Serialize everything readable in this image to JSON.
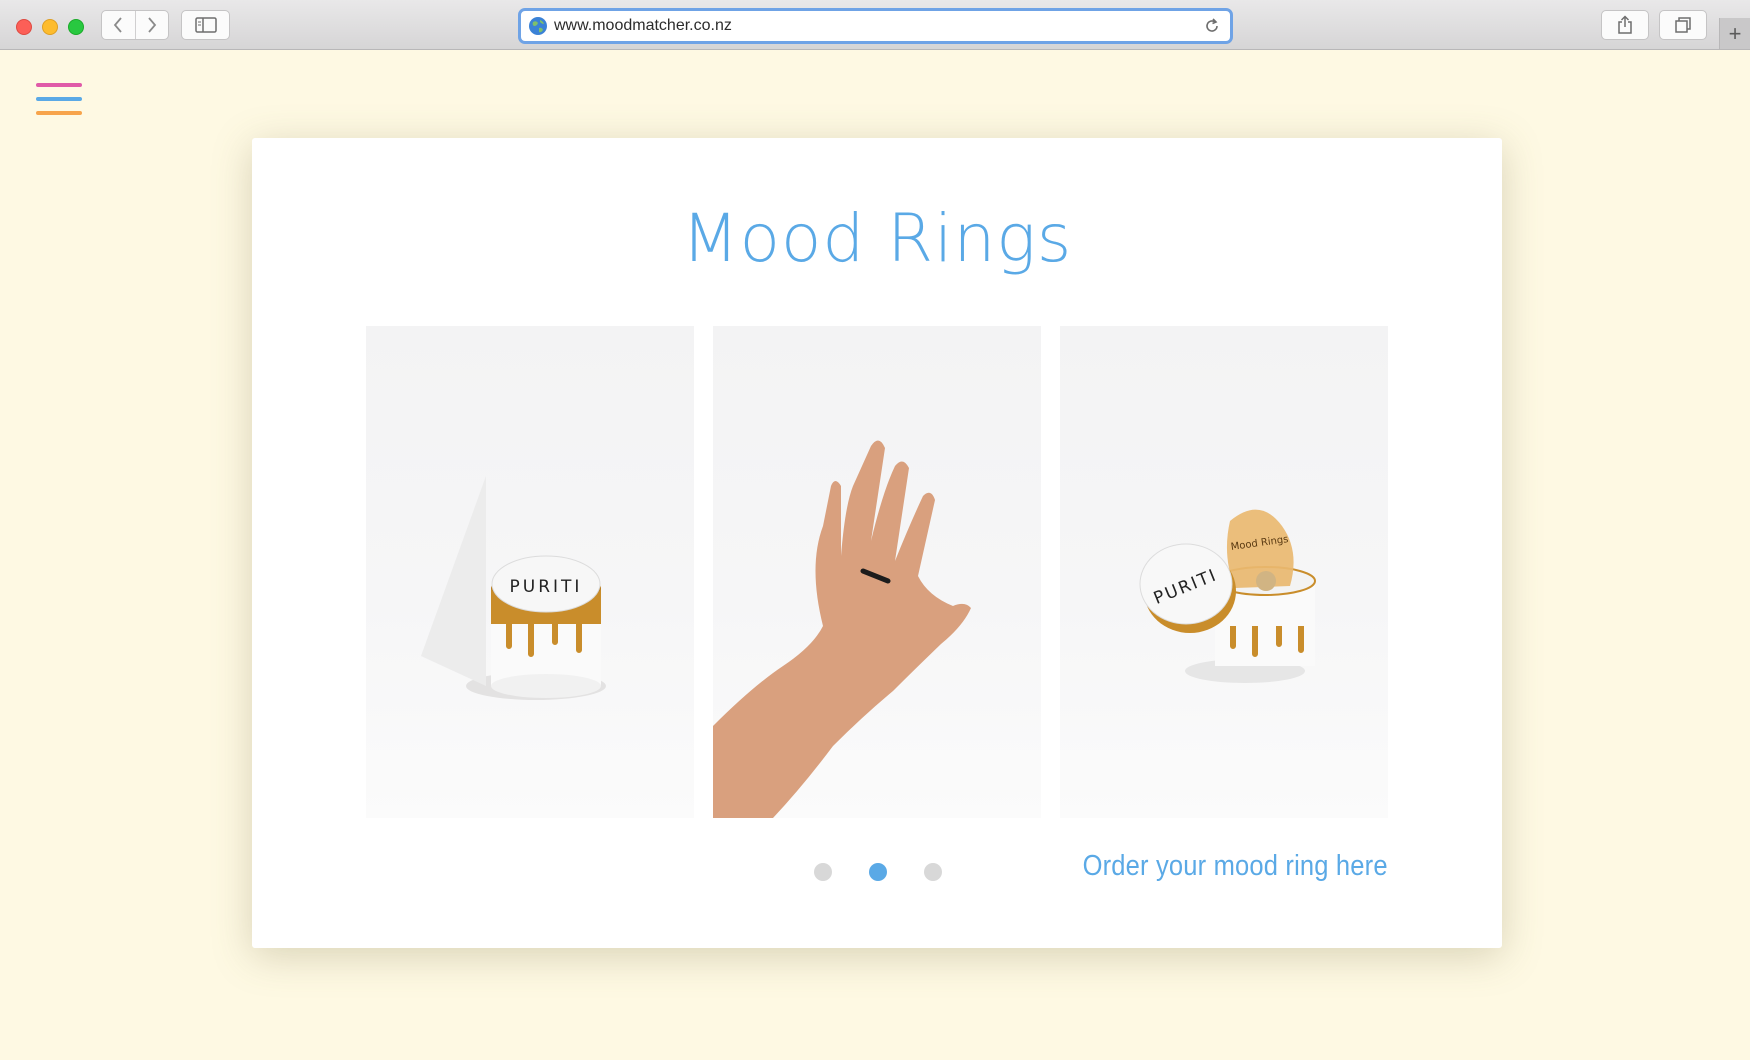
{
  "browser": {
    "url": "www.moodmatcher.co.nz",
    "newtab_label": "+"
  },
  "page": {
    "title": "Mood Rings",
    "cta_label": "Order your mood ring here",
    "carousel": {
      "slides": [
        {
          "brand_text": "PURITI"
        },
        {
          "brand_text": ""
        },
        {
          "brand_text": "PURITI",
          "bag_text": "Mood Rings"
        }
      ],
      "active_index": 1,
      "dot_count": 3
    }
  },
  "colors": {
    "accent": "#5aa9e6",
    "background": "#fef9e3",
    "menu_line_1": "#e05aa8",
    "menu_line_2": "#5aa9e6",
    "menu_line_3": "#f7a44b",
    "gold": "#c98d2b"
  }
}
